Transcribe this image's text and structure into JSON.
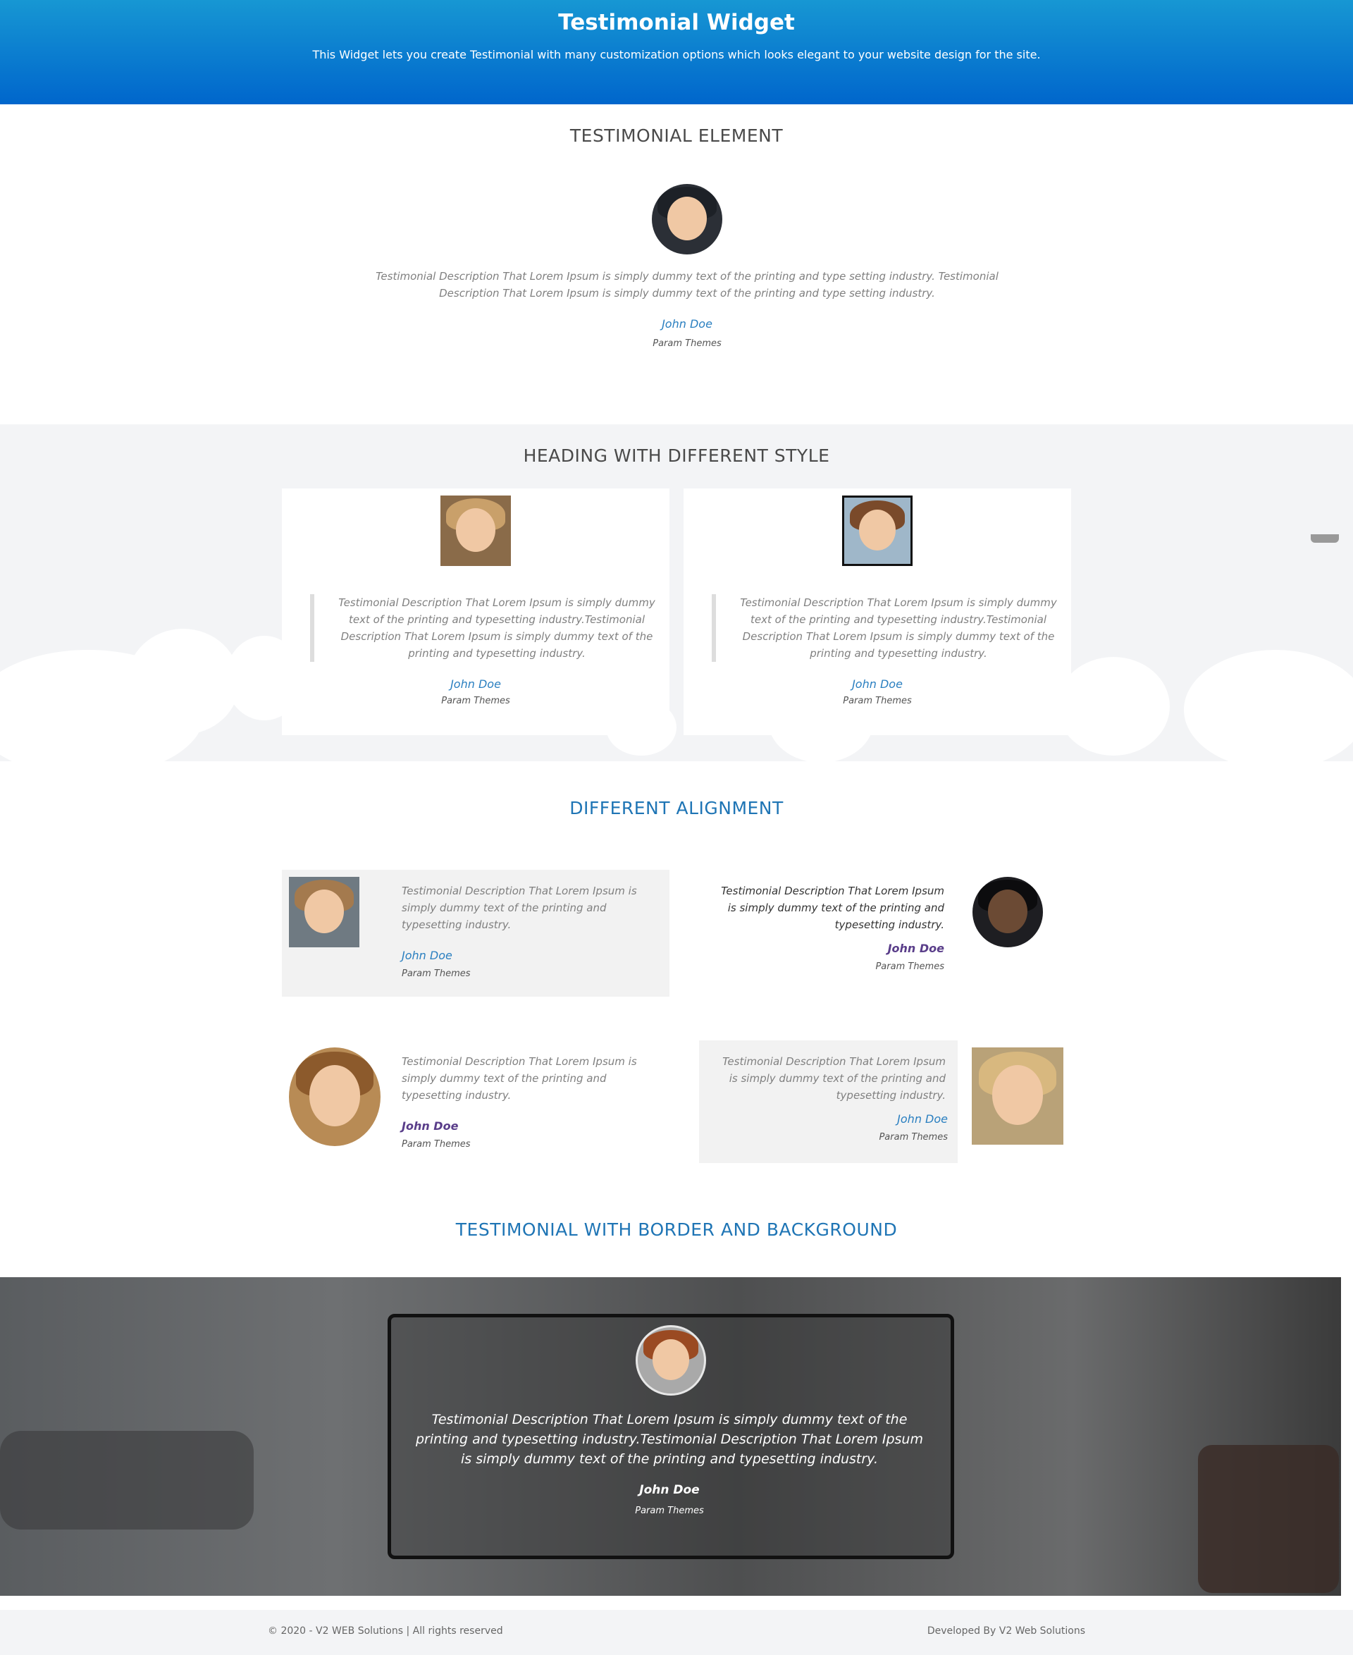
{
  "header": {
    "title": "Testimonial Widget",
    "subtitle": "This Widget lets you create  Testimonial with many customization options which looks elegant to your website design for the site."
  },
  "section1": {
    "title": "TESTIMONIAL ELEMENT",
    "description": "Testimonial Description That Lorem Ipsum is simply dummy text of the printing and type setting industry. Testimonial Description That Lorem Ipsum is simply dummy text of the printing and type setting industry.",
    "name": "John Doe",
    "company": "Param Themes"
  },
  "section2": {
    "title": "HEADING WITH DIFFERENT STYLE",
    "cards": [
      {
        "description": "Testimonial Description That Lorem Ipsum is simply dummy text of the printing and typesetting industry.Testimonial Description That Lorem Ipsum is simply dummy text of the printing and typesetting industry.",
        "name": "John Doe",
        "company": "Param Themes"
      },
      {
        "description": "Testimonial Description That Lorem Ipsum is simply dummy text of the printing and typesetting industry.Testimonial Description That Lorem Ipsum is simply dummy text of the printing and typesetting industry.",
        "name": "John Doe",
        "company": "Param Themes"
      }
    ]
  },
  "section3": {
    "title": "DIFFERENT ALIGNMENT",
    "items": [
      {
        "description": "Testimonial Description That Lorem Ipsum is simply dummy text of the printing and typesetting industry.",
        "name": "John Doe",
        "company": "Param Themes"
      },
      {
        "description": "Testimonial Description That Lorem Ipsum is simply dummy text of the printing and typesetting industry.",
        "name": "John Doe",
        "company": "Param Themes"
      },
      {
        "description": "Testimonial Description That Lorem Ipsum is simply dummy text of the printing and typesetting industry.",
        "name": "John Doe",
        "company": "Param Themes"
      },
      {
        "description": "Testimonial Description That Lorem Ipsum is simply dummy text of the printing and typesetting industry.",
        "name": "John Doe",
        "company": "Param Themes"
      }
    ]
  },
  "section4": {
    "title": "TESTIMONIAL WITH BORDER AND BACKGROUND",
    "description": "Testimonial Description That Lorem Ipsum is simply dummy text of the printing and typesetting industry.Testimonial Description That Lorem Ipsum is simply dummy text of the printing and typesetting industry.",
    "name": "John Doe",
    "company": "Param Themes"
  },
  "footer": {
    "copyright": "© 2020 - V2 WEB Solutions | All rights reserved",
    "developer": "Developed By V2 Web Solutions"
  },
  "colors": {
    "header_gradient_top": "#1797d3",
    "header_gradient_bottom": "#0066cc",
    "accent_blue": "#1f75b5",
    "name_purple": "#5a3e8a"
  }
}
